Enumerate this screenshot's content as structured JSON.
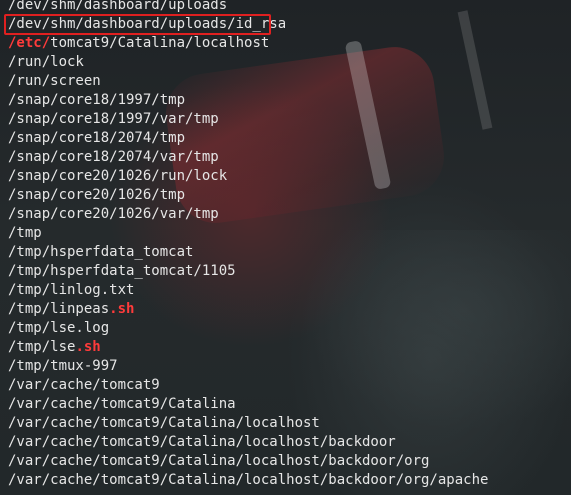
{
  "terminal": {
    "lines": [
      {
        "text": "/dev/shm/dashboard/uploads"
      },
      {
        "text": "/dev/shm/dashboard/uploads/id_rsa",
        "boxed": true
      },
      {
        "prefix": "/etc/",
        "rest": "tomcat9/Catalina/localhost"
      },
      {
        "text": "/run/lock"
      },
      {
        "text": "/run/screen"
      },
      {
        "text": "/snap/core18/1997/tmp"
      },
      {
        "text": "/snap/core18/1997/var/tmp"
      },
      {
        "text": "/snap/core18/2074/tmp"
      },
      {
        "text": "/snap/core18/2074/var/tmp"
      },
      {
        "text": "/snap/core20/1026/run/lock"
      },
      {
        "text": "/snap/core20/1026/tmp"
      },
      {
        "text": "/snap/core20/1026/var/tmp"
      },
      {
        "text": "/tmp"
      },
      {
        "text": "/tmp/hsperfdata_tomcat"
      },
      {
        "text": "/tmp/hsperfdata_tomcat/1105"
      },
      {
        "text": "/tmp/linlog.txt"
      },
      {
        "base": "/tmp/linpeas",
        "suffix": ".sh"
      },
      {
        "text": "/tmp/lse.log"
      },
      {
        "base": "/tmp/lse",
        "suffix": ".sh"
      },
      {
        "text": "/tmp/tmux-997"
      },
      {
        "text": "/var/cache/tomcat9"
      },
      {
        "text": "/var/cache/tomcat9/Catalina"
      },
      {
        "text": "/var/cache/tomcat9/Catalina/localhost"
      },
      {
        "text": "/var/cache/tomcat9/Catalina/localhost/backdoor"
      },
      {
        "text": "/var/cache/tomcat9/Catalina/localhost/backdoor/org"
      },
      {
        "text": "/var/cache/tomcat9/Catalina/localhost/backdoor/org/apache"
      }
    ]
  },
  "colors": {
    "text": "#e6e6e6",
    "highlight_red": "#ff3b3b",
    "box_border": "#e02020"
  }
}
